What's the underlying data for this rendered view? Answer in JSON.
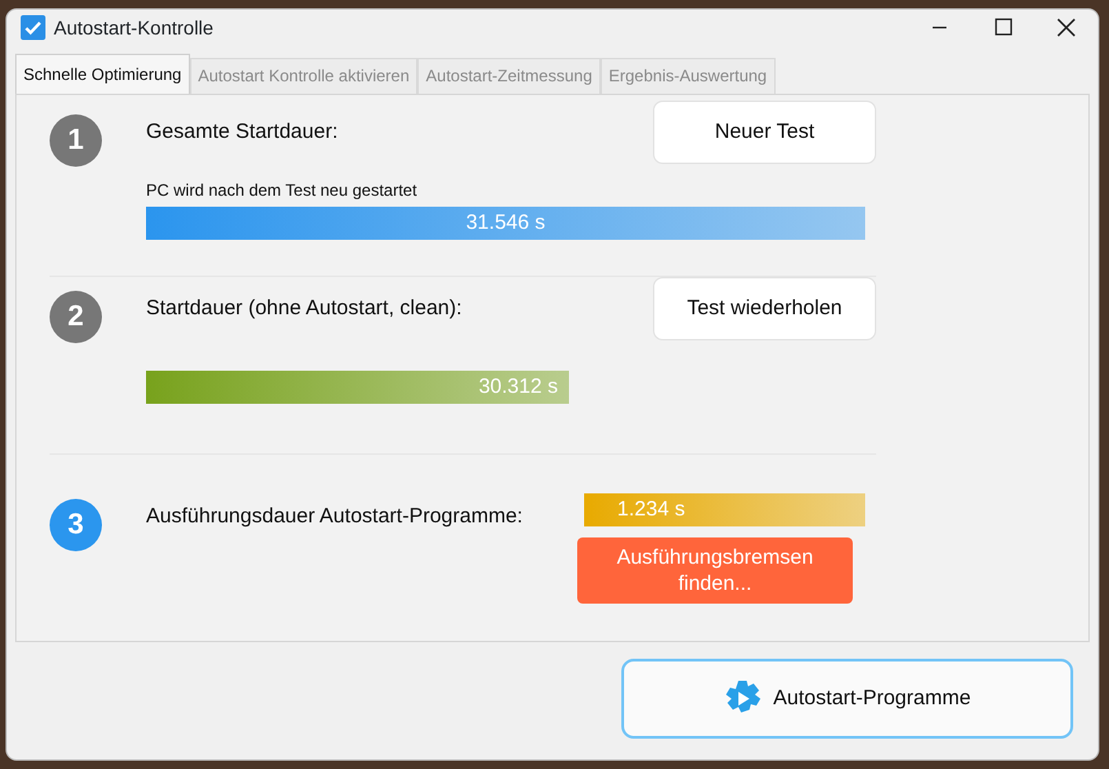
{
  "window": {
    "title": "Autostart-Kontrolle"
  },
  "tabs": [
    {
      "label": "Schnelle Optimierung",
      "selected": true
    },
    {
      "label": "Autostart Kontrolle aktivieren",
      "selected": false
    },
    {
      "label": "Autostart-Zeitmessung",
      "selected": false
    },
    {
      "label": "Ergebnis-Auswertung",
      "selected": false
    }
  ],
  "steps": [
    {
      "number": "1",
      "color": "#777777",
      "label": "Gesamte Startdauer:",
      "button": "Neuer Test",
      "note": "PC wird nach dem Test neu gestartet",
      "bar": {
        "reading": "31.546 s",
        "color": "#2b95ee"
      }
    },
    {
      "number": "2",
      "color": "#777777",
      "label": "Startdauer (ohne Autostart, clean):",
      "button": "Test wiederholen",
      "bar": {
        "reading": "30.312 s",
        "color": "#78a21c"
      }
    },
    {
      "number": "3",
      "color": "#2b96ee",
      "label": "Ausführungsdauer Autostart-Programme:",
      "bar": {
        "reading": "1.234 s",
        "color": "#e8aa00"
      },
      "action": "Ausführungsbremsen finden..."
    }
  ],
  "footer_button": "Autostart-Programme"
}
